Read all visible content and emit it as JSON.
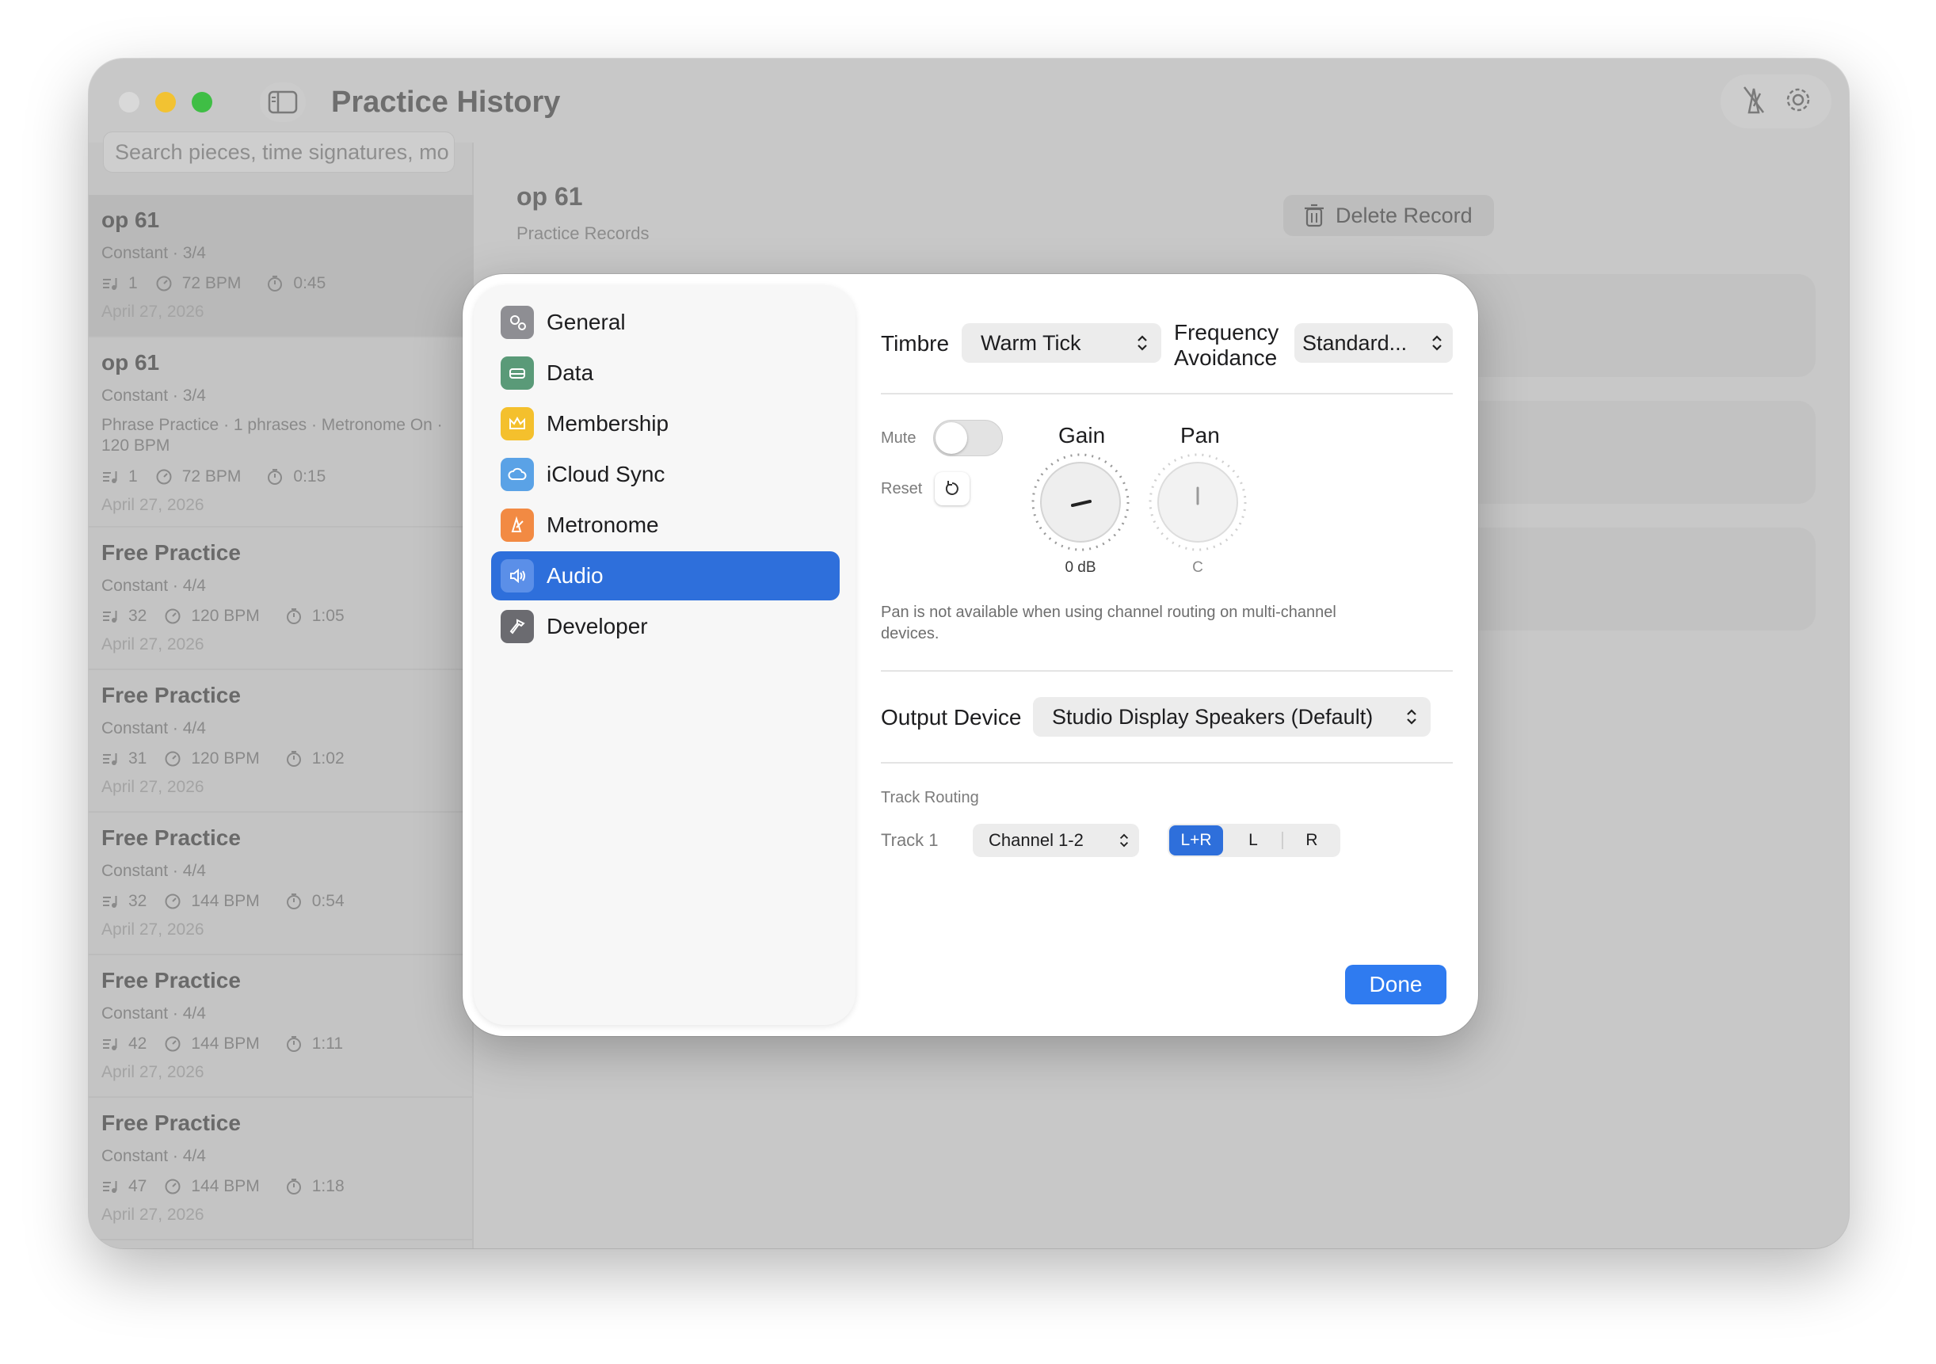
{
  "window": {
    "title": "Practice History"
  },
  "search": {
    "placeholder": "Search pieces, time signatures, mo"
  },
  "records": [
    {
      "title": "op 61",
      "subtitle": "Constant · 3/4",
      "phrases": "1",
      "bpm": "72 BPM",
      "duration": "0:45",
      "date": "April 27, 2026",
      "selected": true
    },
    {
      "title": "op 61",
      "subtitle": "Constant · 3/4",
      "detail": "Phrase Practice · 1 phrases · Metronome On ·",
      "detail2": "120 BPM",
      "phrases": "1",
      "bpm": "72 BPM",
      "duration": "0:15",
      "date": "April 27, 2026"
    },
    {
      "title": "Free Practice",
      "subtitle": "Constant · 4/4",
      "phrases": "32",
      "bpm": "120 BPM",
      "duration": "1:05",
      "date": "April 27, 2026"
    },
    {
      "title": "Free Practice",
      "subtitle": "Constant · 4/4",
      "phrases": "31",
      "bpm": "120 BPM",
      "duration": "1:02",
      "date": "April 27, 2026"
    },
    {
      "title": "Free Practice",
      "subtitle": "Constant · 4/4",
      "phrases": "32",
      "bpm": "144 BPM",
      "duration": "0:54",
      "date": "April 27, 2026"
    },
    {
      "title": "Free Practice",
      "subtitle": "Constant · 4/4",
      "phrases": "42",
      "bpm": "144 BPM",
      "duration": "1:11",
      "date": "April 27, 2026"
    },
    {
      "title": "Free Practice",
      "subtitle": "Constant · 4/4",
      "phrases": "47",
      "bpm": "144 BPM",
      "duration": "1:18",
      "date": "April 27, 2026"
    }
  ],
  "detail": {
    "title": "op 61",
    "subtitle": "Practice Records",
    "delete_label": "Delete Record"
  },
  "settings": {
    "nav": [
      {
        "label": "General",
        "icon": "gears-icon",
        "color": "#8e8e93"
      },
      {
        "label": "Data",
        "icon": "drive-icon",
        "color": "#5a9a78"
      },
      {
        "label": "Membership",
        "icon": "crown-icon",
        "color": "#f4c02d"
      },
      {
        "label": "iCloud Sync",
        "icon": "cloud-icon",
        "color": "#5aa2e6"
      },
      {
        "label": "Metronome",
        "icon": "metronome-icon",
        "color": "#f28a43"
      },
      {
        "label": "Audio",
        "icon": "speaker-icon",
        "color": "#5b8fe8",
        "active": true
      },
      {
        "label": "Developer",
        "icon": "hammer-icon",
        "color": "#6b6b70"
      }
    ],
    "audio": {
      "timbre_label": "Timbre",
      "timbre_value": "Warm Tick",
      "freq_label_1": "Frequency",
      "freq_label_2": "Avoidance",
      "freq_value": "Standard...",
      "mute_label": "Mute",
      "mute_on": false,
      "reset_label": "Reset",
      "gain_label": "Gain",
      "gain_value": "0 dB",
      "pan_label": "Pan",
      "pan_value": "C",
      "pan_note": "Pan is not available when using channel routing on multi-channel devices.",
      "output_label": "Output Device",
      "output_value": "Studio Display Speakers (Default)",
      "routing_label": "Track Routing",
      "track_label": "Track 1",
      "channel_value": "Channel 1-2",
      "seg_options": [
        "L+R",
        "L",
        "R"
      ],
      "seg_selected": "L+R"
    },
    "done_label": "Done"
  }
}
